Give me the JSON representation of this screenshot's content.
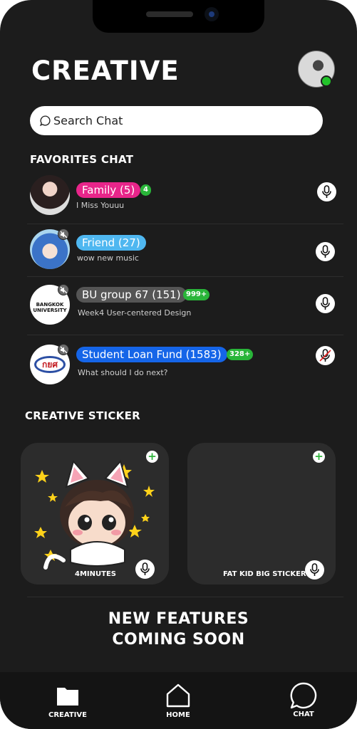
{
  "header": {
    "title": "CREATIVE"
  },
  "search": {
    "placeholder": "Search Chat"
  },
  "favorites": {
    "heading": "FAVORITES CHAT",
    "chats": [
      {
        "name": "Family (5)",
        "badge": "4",
        "preview": "I Miss Youuu",
        "color": "#e8258a",
        "muted": false,
        "mic_off": false
      },
      {
        "name": "Friend (27)",
        "badge": "",
        "preview": "wow new music",
        "color": "#4fb7f0",
        "muted": true,
        "mic_off": false
      },
      {
        "name": "BU group 67 (151)",
        "badge": "999+",
        "preview": "Week4 User-centered Design",
        "color": "#555555",
        "muted": true,
        "mic_off": false
      },
      {
        "name": "Student Loan Fund (1583)",
        "badge": "328+",
        "preview": "What should I do next?",
        "color": "#1565e8",
        "muted": true,
        "mic_off": true
      }
    ],
    "avatar_logo_text": "BANGKOK UNIVERSITY",
    "avatar_loan_text": "กยศ"
  },
  "stickers": {
    "heading": "CREATIVE STICKER",
    "items": [
      {
        "label": "4MINUTES"
      },
      {
        "label": "FAT KID BIG STICKER"
      }
    ]
  },
  "coming_soon": {
    "line1": "NEW FEATURES",
    "line2": "COMING SOON"
  },
  "nav": {
    "items": [
      {
        "label": "CREATIVE",
        "icon": "folder-icon"
      },
      {
        "label": "HOME",
        "icon": "home-icon"
      },
      {
        "label": "CHAT",
        "icon": "chat-icon"
      }
    ]
  },
  "colors": {
    "background": "#1c1c1c",
    "online": "#22c32a",
    "badge": "#29b539"
  }
}
